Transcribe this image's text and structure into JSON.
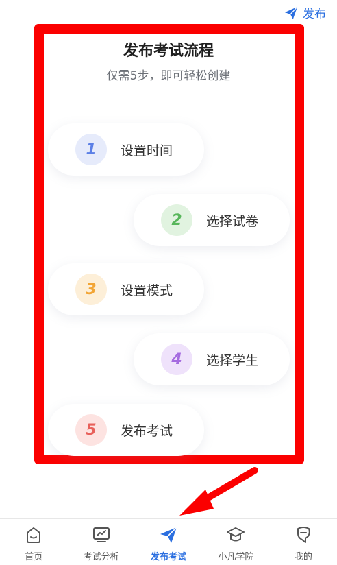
{
  "header": {
    "publish_label": "发布",
    "publish_icon": "paper-plane-icon"
  },
  "main": {
    "title": "发布考试流程",
    "subtitle": "仅需5步，即可轻松创建",
    "steps": [
      {
        "number": "1",
        "label": "设置时间",
        "color": "#5b7fe6",
        "bg": "#e6ebfb"
      },
      {
        "number": "2",
        "label": "选择试卷",
        "color": "#57b65a",
        "bg": "#e1f3e0"
      },
      {
        "number": "3",
        "label": "设置模式",
        "color": "#f2a535",
        "bg": "#fdefd8"
      },
      {
        "number": "4",
        "label": "选择学生",
        "color": "#a56be0",
        "bg": "#efe2fb"
      },
      {
        "number": "5",
        "label": "发布考试",
        "color": "#e8605a",
        "bg": "#fde3e1"
      }
    ]
  },
  "tabbar": {
    "tabs": [
      {
        "label": "首页",
        "icon": "home-icon",
        "active": false
      },
      {
        "label": "考试分析",
        "icon": "analytics-icon",
        "active": false
      },
      {
        "label": "发布考试",
        "icon": "paper-plane-icon",
        "active": true
      },
      {
        "label": "小凡学院",
        "icon": "graduation-cap-icon",
        "active": false
      },
      {
        "label": "我的",
        "icon": "profile-icon",
        "active": false
      }
    ]
  },
  "colors": {
    "accent": "#2b6fe0",
    "annotation": "#fb0000"
  }
}
